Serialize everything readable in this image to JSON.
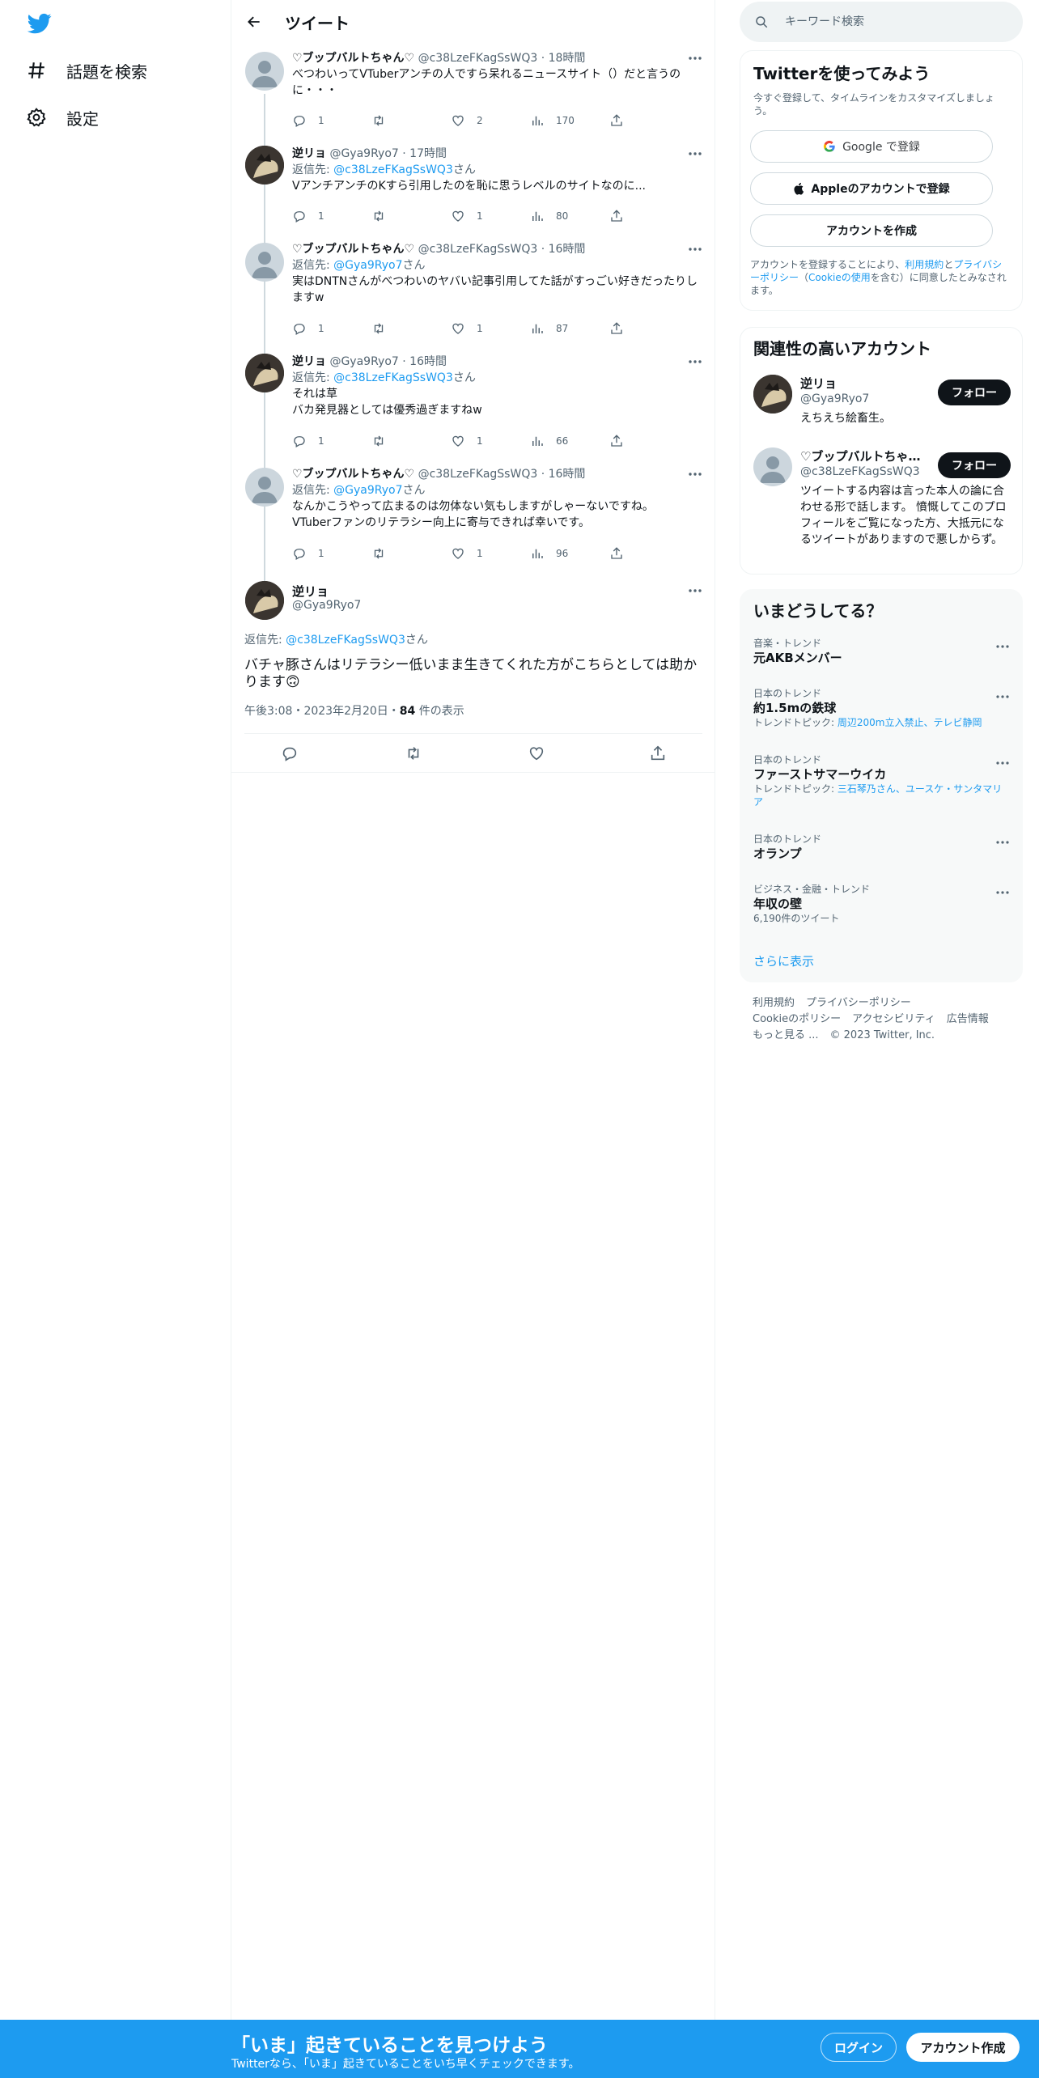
{
  "nav": {
    "explore_label": "話題を検索",
    "settings_label": "設定"
  },
  "header": {
    "title": "ツイート"
  },
  "thread": [
    {
      "name": "♡ブップバルトちゃん♡",
      "handle": "@c38LzeFKagSsWQ3",
      "time": "18時間",
      "reply_prefix": "",
      "reply_to": "",
      "reply_suffix": "",
      "text": "べつわいってVTuberアンチの人ですら呆れるニュースサイト（）だと言うのに・・・",
      "replies": "1",
      "retweets": "",
      "likes": "2",
      "views": "170"
    },
    {
      "name": "逆リョ",
      "handle": "@Gya9Ryo7",
      "time": "17時間",
      "reply_prefix": "返信先: ",
      "reply_to": "@c38LzeFKagSsWQ3",
      "reply_suffix": "さん",
      "text": "VアンチアンチのKすら引用したのを恥に思うレベルのサイトなのに...",
      "replies": "1",
      "retweets": "",
      "likes": "1",
      "views": "80"
    },
    {
      "name": "♡ブップバルトちゃん♡",
      "handle": "@c38LzeFKagSsWQ3",
      "time": "16時間",
      "reply_prefix": "返信先: ",
      "reply_to": "@Gya9Ryo7",
      "reply_suffix": "さん",
      "text": "実はDNTNさんがべつわいのヤバい記事引用してた話がすっごい好きだったりしますw",
      "replies": "1",
      "retweets": "",
      "likes": "1",
      "views": "87"
    },
    {
      "name": "逆リョ",
      "handle": "@Gya9Ryo7",
      "time": "16時間",
      "reply_prefix": "返信先: ",
      "reply_to": "@c38LzeFKagSsWQ3",
      "reply_suffix": "さん",
      "text": "それは草\nバカ発見器としては優秀過ぎますねw",
      "replies": "1",
      "retweets": "",
      "likes": "1",
      "views": "66"
    },
    {
      "name": "♡ブップバルトちゃん♡",
      "handle": "@c38LzeFKagSsWQ3",
      "time": "16時間",
      "reply_prefix": "返信先: ",
      "reply_to": "@Gya9Ryo7",
      "reply_suffix": "さん",
      "text": "なんかこうやって広まるのは勿体ない気もしますがしゃーないですね。\nVTuberファンのリテラシー向上に寄与できれば幸いです。",
      "replies": "1",
      "retweets": "",
      "likes": "1",
      "views": "96"
    }
  ],
  "focus": {
    "name": "逆リョ",
    "handle": "@Gya9Ryo7",
    "reply_prefix": "返信先: ",
    "reply_to": "@c38LzeFKagSsWQ3",
    "reply_suffix": "さん",
    "text": "バチャ豚さんはリテラシー低いまま生きてくれた方がこちらとしては助かります🙃",
    "time": "午後3:08・2023年2月20日・",
    "views_count": "84",
    "views_label": " 件の表示"
  },
  "search": {
    "placeholder": "キーワード検索"
  },
  "signup_card": {
    "title": "Twitterを使ってみよう",
    "subtitle": "今すぐ登録して、タイムラインをカスタマイズしましょう。",
    "google_label": "Google で登録",
    "apple_label": "Appleのアカウントで登録",
    "create_label": "アカウントを作成",
    "terms_prefix": "アカウントを登録することにより、",
    "terms_link": "利用規約",
    "terms_and": "と",
    "privacy_link": "プライバシーポリシー",
    "cookie_open": "（",
    "cookie_link": "Cookieの使用",
    "terms_suffix": "を含む）に同意したとみなされます。"
  },
  "related": {
    "title": "関連性の高いアカウント",
    "accounts": [
      {
        "name": "逆リョ",
        "handle": "@Gya9Ryo7",
        "bio": "えちえち絵畜生。",
        "follow_label": "フォロー"
      },
      {
        "name": "♡ブップバルトちゃ…",
        "handle": "@c38LzeFKagSsWQ3",
        "bio": "ツイートする内容は言った本人の論に合わせる形で話します。 憤慨してこのプロフィールをご覧になった方、大抵元になるツイートがありますので悪しからず。",
        "follow_label": "フォロー"
      }
    ]
  },
  "trends": {
    "title": "いまどうしてる？",
    "items": [
      {
        "meta": "音楽・トレンド",
        "title": "元AKBメンバー",
        "topic_label": "",
        "topic_links": "",
        "count": ""
      },
      {
        "meta": "日本のトレンド",
        "title": "約1.5mの鉄球",
        "topic_label": "トレンドトピック: ",
        "topic_links": "周辺200m立入禁止、テレビ静岡",
        "count": ""
      },
      {
        "meta": "日本のトレンド",
        "title": "ファーストサマーウイカ",
        "topic_label": "トレンドトピック: ",
        "topic_links": "三石琴乃さん、ユースケ・サンタマリア",
        "count": ""
      },
      {
        "meta": "日本のトレンド",
        "title": "オランプ",
        "topic_label": "",
        "topic_links": "",
        "count": ""
      },
      {
        "meta": "ビジネス・金融・トレンド",
        "title": "年収の壁",
        "topic_label": "",
        "topic_links": "",
        "count": "6,190件のツイート"
      }
    ],
    "show_more": "さらに表示"
  },
  "footer": {
    "terms": "利用規約",
    "privacy": "プライバシーポリシー",
    "cookies": "Cookieのポリシー",
    "accessibility": "アクセシビリティ",
    "ads": "広告情報",
    "more": "もっと見る ...",
    "copyright": "© 2023 Twitter, Inc."
  },
  "banner": {
    "title": "「いま」起きていることを見つけよう",
    "subtitle": "Twitterなら、「いま」起きていることをいち早くチェックできます。",
    "login_label": "ログイン",
    "signup_label": "アカウント作成"
  },
  "colors": {
    "accent": "#1d9bf0",
    "text": "#0f1419",
    "muted": "#536471",
    "border": "#eff3f4"
  }
}
